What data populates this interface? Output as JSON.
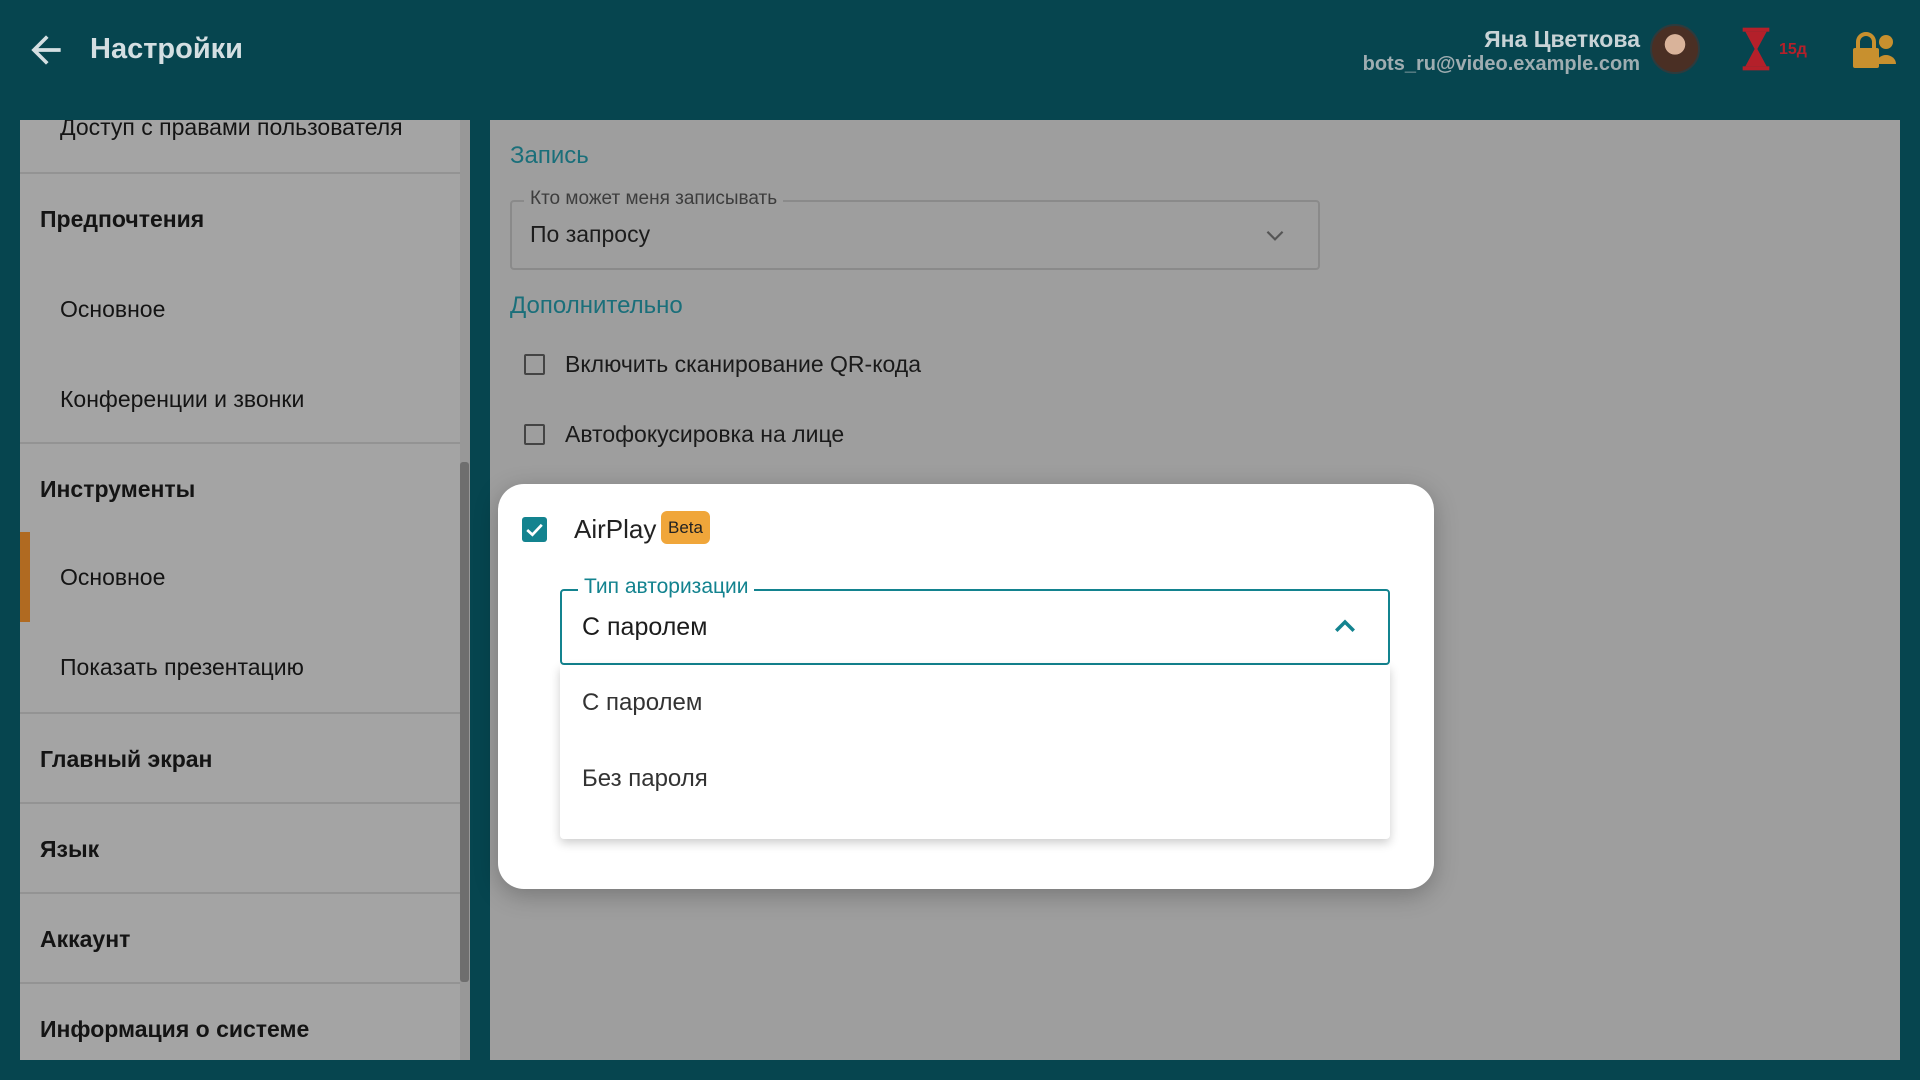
{
  "header": {
    "title": "Настройки",
    "user_name": "Яна Цветкова",
    "user_email": "bots_ru@video.example.com",
    "timer_text": "15д",
    "accent_color": "#13838f"
  },
  "sidebar": {
    "items": [
      {
        "label": "Доступ с правами пользователя",
        "type": "sub"
      },
      {
        "label": "Предпочтения",
        "type": "section"
      },
      {
        "label": "Основное",
        "type": "sub"
      },
      {
        "label": "Конференции и звонки",
        "type": "sub"
      },
      {
        "label": "Инструменты",
        "type": "section"
      },
      {
        "label": "Основное",
        "type": "sub",
        "active": true
      },
      {
        "label": "Показать презентацию",
        "type": "sub"
      },
      {
        "label": "Главный экран",
        "type": "section"
      },
      {
        "label": "Язык",
        "type": "section"
      },
      {
        "label": "Аккаунт",
        "type": "section"
      },
      {
        "label": "Информация о системе",
        "type": "section"
      }
    ]
  },
  "main": {
    "recording": {
      "title": "Запись",
      "field_label": "Кто может меня записывать",
      "field_value": "По запросу"
    },
    "additional": {
      "title": "Дополнительно",
      "qr_label": "Включить сканирование QR-кода",
      "qr_checked": false,
      "face_label": "Автофокусировка на лице",
      "face_checked": false
    }
  },
  "airplay": {
    "label": "AirPlay",
    "checked": true,
    "badge": "Beta",
    "auth_label": "Тип авторизации",
    "auth_value": "С паролем",
    "options": [
      "С паролем",
      "Без пароля"
    ]
  }
}
